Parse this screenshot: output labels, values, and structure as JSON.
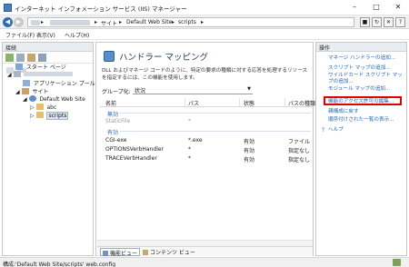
{
  "window": {
    "title": "インターネット インフォメーション サービス (IIS) マネージャー"
  },
  "address": {
    "crumbs": [
      "サイト",
      "Default Web Site",
      "scripts"
    ],
    "separator": "▸"
  },
  "menu": {
    "items": [
      "ファイル(F)",
      "表示(V)",
      "ヘルプ(H)"
    ]
  },
  "connections": {
    "header": "接続",
    "tree": [
      {
        "label": "スタート ページ"
      },
      {
        "label": "アプリケーション プール"
      },
      {
        "label": "サイト"
      },
      {
        "label": "Default Web Site"
      },
      {
        "label": "abc"
      },
      {
        "label": "scripts"
      }
    ]
  },
  "main": {
    "title": "ハンドラー マッピング",
    "description": "DLL およびマネージ コードのように、特定の要求の種類に対する応答を処理するリソースを指定するには、この機能を使用します。",
    "group_label": "グループ化:",
    "group_value": "状況",
    "columns": [
      "名前",
      "パス",
      "状態",
      "パスの種類"
    ],
    "groups": [
      {
        "label": "無効",
        "rows": [
          {
            "name": "StaticFile",
            "path": "*",
            "state": "",
            "type": ""
          }
        ]
      },
      {
        "label": "有効",
        "rows": [
          {
            "name": "CGI-exe",
            "path": "*.exe",
            "state": "有効",
            "type": "ファイル"
          },
          {
            "name": "OPTIONSVerbHandler",
            "path": "*",
            "state": "有効",
            "type": "指定なし"
          },
          {
            "name": "TRACEVerbHandler",
            "path": "*",
            "state": "有効",
            "type": "指定なし"
          }
        ]
      }
    ],
    "tabs": [
      "機能ビュー",
      "コンテンツ ビュー"
    ]
  },
  "actions": {
    "header": "操作",
    "links": [
      "マネージ ハンドラーの追加...",
      "スクリプト マップの追加...",
      "ワイルドカード スクリプト マップの追加...",
      "モジュール マップの追加...",
      "機能のアクセス許可の編集...",
      "順序付けされた一覧の表示...",
      "ヘルプ"
    ],
    "revert": "親構成に戻す"
  },
  "status": {
    "text": "構成:'Default Web Site/scripts' web.config"
  },
  "colors": {
    "link": "#1f62b3",
    "highlight": "#e00000",
    "group": "#2a6dbb"
  }
}
